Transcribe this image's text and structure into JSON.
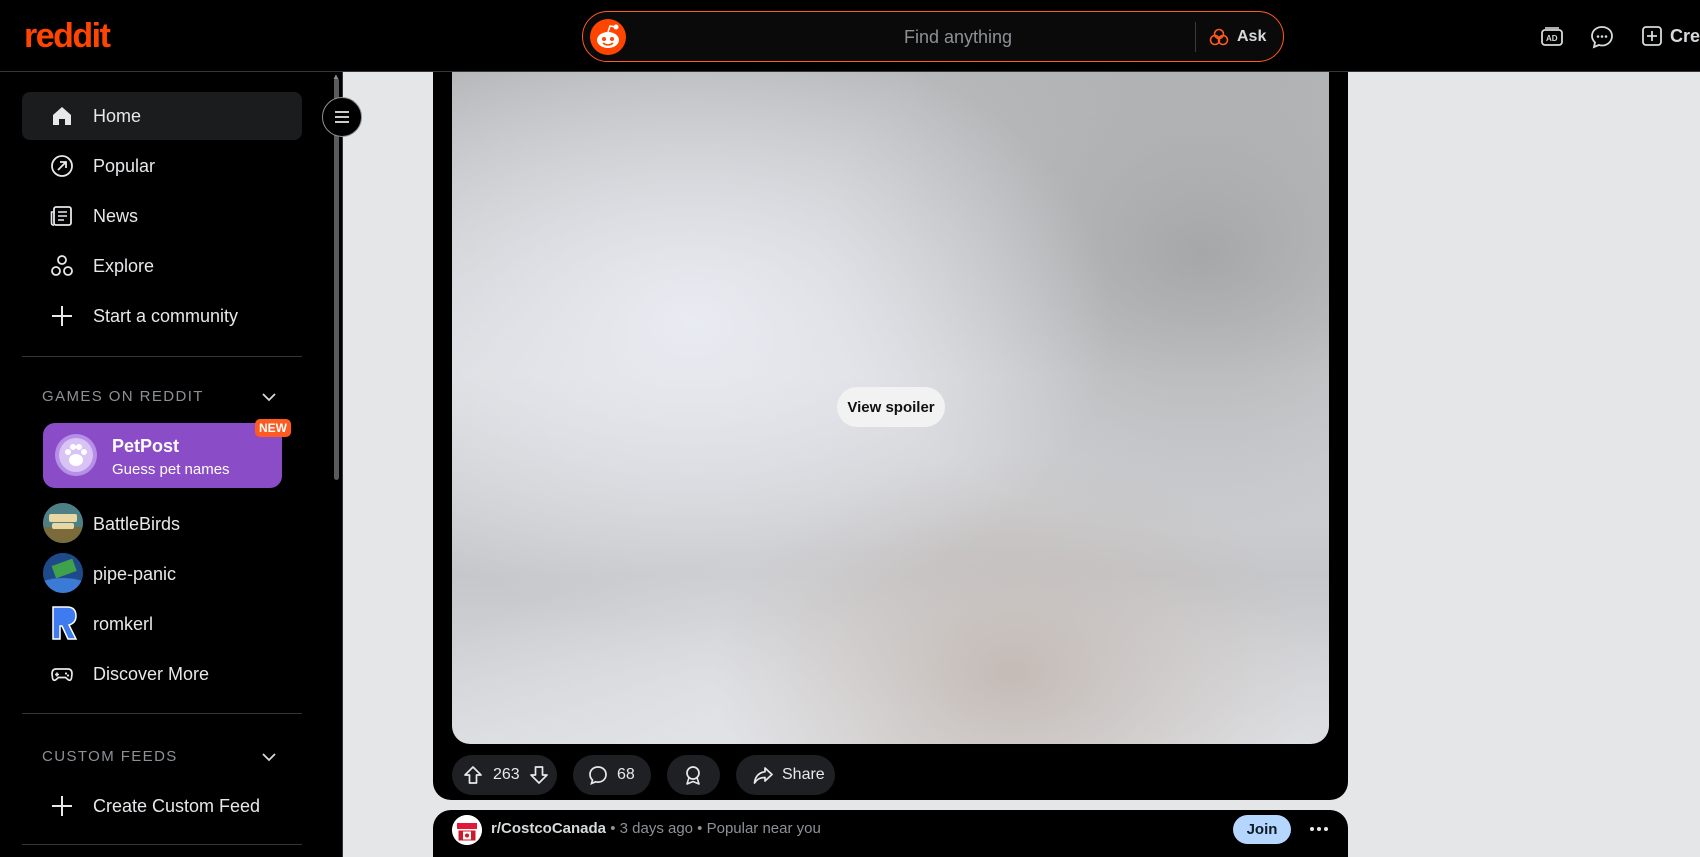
{
  "header": {
    "logo": "reddit",
    "search_placeholder": "Find anything",
    "ask_label": "Ask",
    "create_label": "Cre",
    "icons": [
      "ad-icon",
      "chat-icon",
      "create-icon"
    ]
  },
  "sidebar": {
    "nav": [
      {
        "label": "Home",
        "icon": "home-icon",
        "active": true
      },
      {
        "label": "Popular",
        "icon": "popular-icon"
      },
      {
        "label": "News",
        "icon": "news-icon"
      },
      {
        "label": "Explore",
        "icon": "explore-icon"
      },
      {
        "label": "Start a community",
        "icon": "plus-icon"
      }
    ],
    "games_title": "GAMES ON REDDIT",
    "featured_game": {
      "name": "PetPost",
      "subtitle": "Guess pet names",
      "badge": "NEW"
    },
    "games": [
      "BattleBirds",
      "pipe-panic",
      "romkerl",
      "Discover More"
    ],
    "custom_feeds_title": "CUSTOM FEEDS",
    "create_custom_feed": "Create Custom Feed"
  },
  "post": {
    "spoiler_label": "View spoiler",
    "votes": "263",
    "comments": "68",
    "share_label": "Share"
  },
  "next_post": {
    "subreddit": "r/CostcoCanada",
    "meta": "• 3 days ago • Popular near you",
    "join_label": "Join"
  },
  "colors": {
    "brand": "#ff4500",
    "featured_game_bg": "#8b4cc7",
    "join_bg": "#b4d6ff"
  }
}
